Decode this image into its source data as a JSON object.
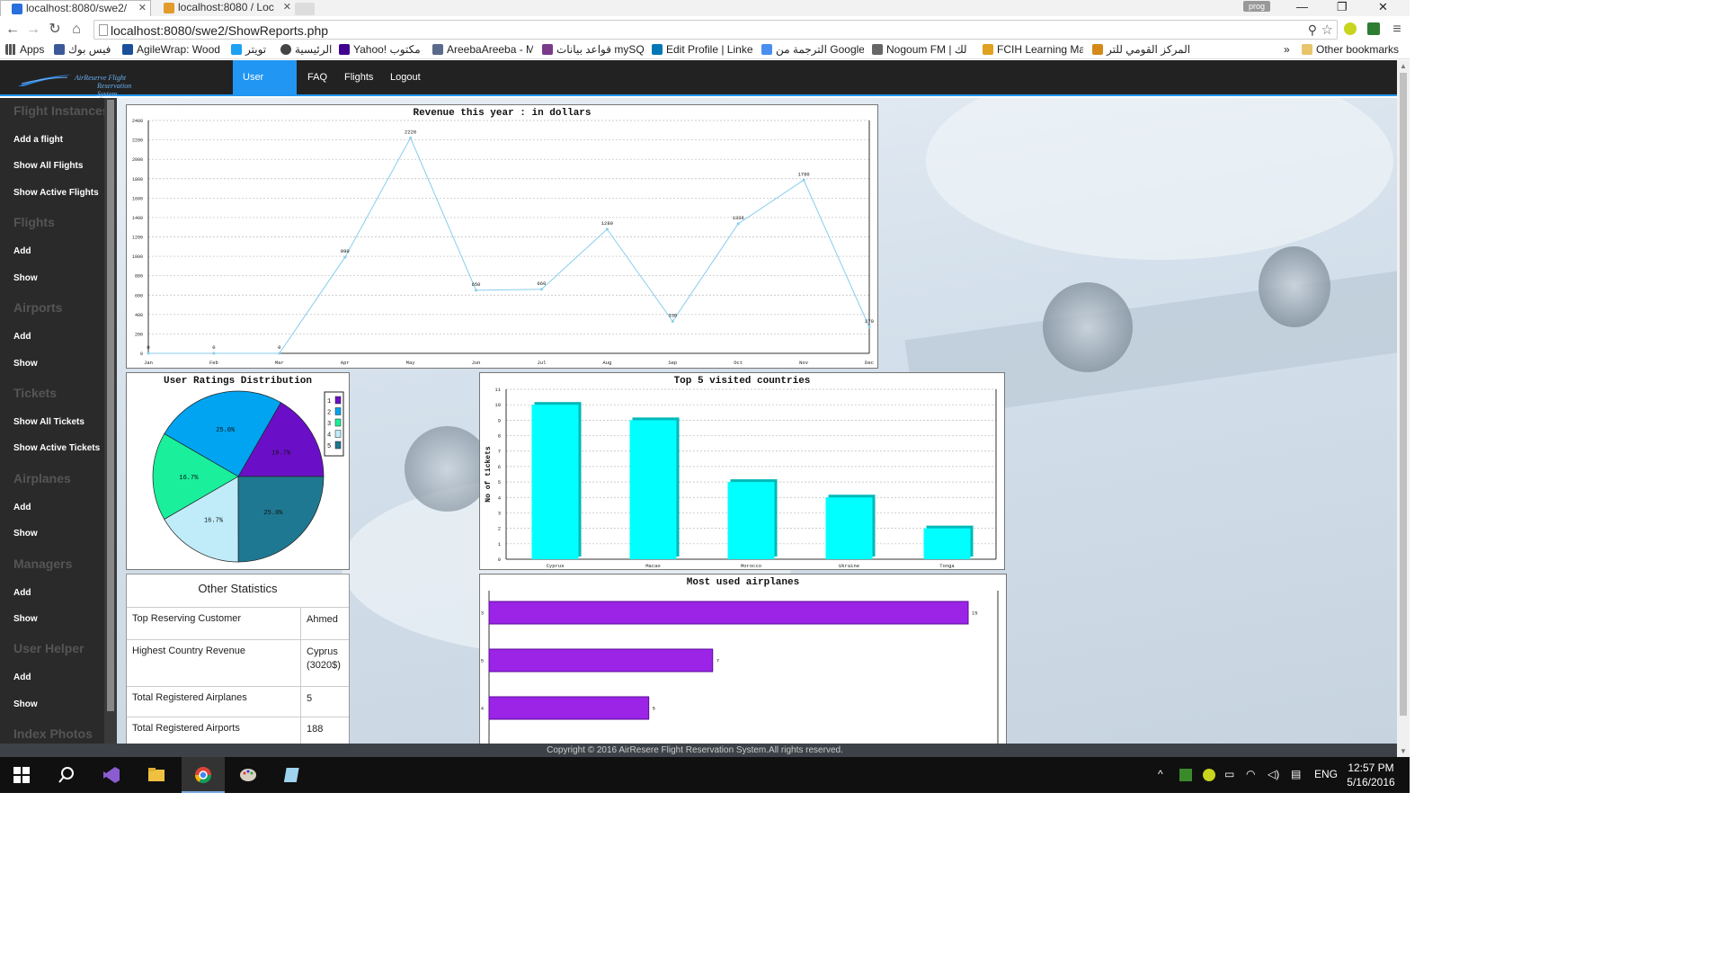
{
  "browser": {
    "tabs": [
      {
        "label": "localhost:8080/swe2/",
        "active": true
      },
      {
        "label": "localhost:8080 / Loc",
        "active": false
      }
    ],
    "profile_badge": "prog",
    "url": "localhost:8080/swe2/ShowReports.php",
    "bookmarks": [
      {
        "label": "Apps",
        "icon": "apps-grid-icon"
      },
      {
        "label": "فيس بوك",
        "icon": "facebook-icon"
      },
      {
        "label": "AgileWrap: Wood",
        "icon": "agilewrap-icon"
      },
      {
        "label": "تويتر",
        "icon": "twitter-icon"
      },
      {
        "label": "الرئيسية",
        "icon": "gear-icon"
      },
      {
        "label": "Yahoo! مكتوب",
        "icon": "yahoo-icon"
      },
      {
        "label": "AreebaAreeba - M",
        "icon": "areeba-icon"
      },
      {
        "label": "قواعد بيانات mySQL",
        "icon": "mysql-icon"
      },
      {
        "label": "Edit Profile | Linke",
        "icon": "linkedin-icon"
      },
      {
        "label": "الترجمة من Google",
        "icon": "translate-icon"
      },
      {
        "label": "Nogoum FM | لك",
        "icon": "nogoum-icon"
      },
      {
        "label": "FCIH Learning Ma",
        "icon": "fcih-icon"
      },
      {
        "label": "المركز القومي للتر",
        "icon": "markaz-icon"
      }
    ],
    "other_bookmarks": "Other bookmarks",
    "overflow": "»"
  },
  "site": {
    "logo_line1": "AirReserve Flight",
    "logo_line2": "Reservation System",
    "nav": [
      {
        "label": "User Panel",
        "active": true
      },
      {
        "label": "FAQ",
        "active": false
      },
      {
        "label": "Flights",
        "active": false
      },
      {
        "label": "Logout",
        "active": false
      }
    ],
    "accent": "#2196f3"
  },
  "sidebar": {
    "sections": [
      {
        "title": "Flight Instances",
        "items": [
          "Add a flight",
          "Show All Flights",
          "Show Active Flights"
        ]
      },
      {
        "title": "Flights",
        "items": [
          "Add",
          "Show"
        ]
      },
      {
        "title": "Airports",
        "items": [
          "Add",
          "Show"
        ]
      },
      {
        "title": "Tickets",
        "items": [
          "Show All Tickets",
          "Show Active Tickets"
        ]
      },
      {
        "title": "Airplanes",
        "items": [
          "Add",
          "Show"
        ]
      },
      {
        "title": "Managers",
        "items": [
          "Add",
          "Show"
        ]
      },
      {
        "title": "User Helper",
        "items": [
          "Add",
          "Show"
        ]
      },
      {
        "title": "Index Photos",
        "items": []
      }
    ]
  },
  "chart_data": [
    {
      "type": "line",
      "title": "Revenue this year : in dollars",
      "categories": [
        "Jan",
        "Feb",
        "Mar",
        "Apr",
        "May",
        "Jun",
        "Jul",
        "Aug",
        "Sep",
        "Oct",
        "Nov",
        "Dec"
      ],
      "values": [
        0,
        0,
        0,
        990,
        2220,
        650,
        660,
        1280,
        330,
        1336,
        1786,
        270
      ],
      "ylim": [
        0,
        2400
      ],
      "yticks": [
        0,
        200,
        400,
        600,
        800,
        1000,
        1200,
        1400,
        1600,
        1800,
        2000,
        2200,
        2400
      ],
      "color": "#87ceeb",
      "grid": true
    },
    {
      "type": "pie",
      "title": "User Ratings Distribution",
      "labels": [
        "1",
        "2",
        "3",
        "4",
        "5"
      ],
      "values": [
        16.7,
        25.0,
        16.7,
        16.7,
        25.0
      ],
      "value_labels": [
        "16.7%",
        "25.0%",
        "16.7%",
        "16.7%",
        "25.0%"
      ],
      "colors": [
        "#6a0fc7",
        "#00a4f0",
        "#1aef9b",
        "#c0ecfa",
        "#1f7891"
      ],
      "legend": "top-right"
    },
    {
      "type": "bar",
      "title": "Top 5 visited countries",
      "ylabel": "No of tickets",
      "categories": [
        "Cyprus",
        "Macao",
        "Morocco",
        "Ukraine",
        "Tonga"
      ],
      "values": [
        10,
        9,
        5,
        4,
        2
      ],
      "ylim": [
        0,
        11
      ],
      "yticks": [
        0,
        1,
        2,
        3,
        4,
        5,
        6,
        7,
        8,
        9,
        10,
        11
      ],
      "color": "#00ffff",
      "grid": true
    },
    {
      "type": "bar",
      "orientation": "horizontal",
      "title": "Most used airplanes",
      "categories": [
        "3",
        "5",
        "4"
      ],
      "values": [
        15,
        7,
        5
      ],
      "color": "#9b24e6"
    }
  ],
  "stats": {
    "title": "Other Statistics",
    "rows": [
      {
        "label": "Top Reserving Customer",
        "value": "Ahmed"
      },
      {
        "label": "Highest Country Revenue",
        "value": "Cyprus (3020$)"
      },
      {
        "label": "Total Registered Airplanes",
        "value": "5"
      },
      {
        "label": "Total Registered Airports",
        "value": "188"
      }
    ]
  },
  "footer": "Copyright © 2016 AirResere Flight Reservation System.All rights reserved.",
  "taskbar": {
    "language": "ENG",
    "time": "12:57 PM",
    "date": "5/16/2016"
  }
}
